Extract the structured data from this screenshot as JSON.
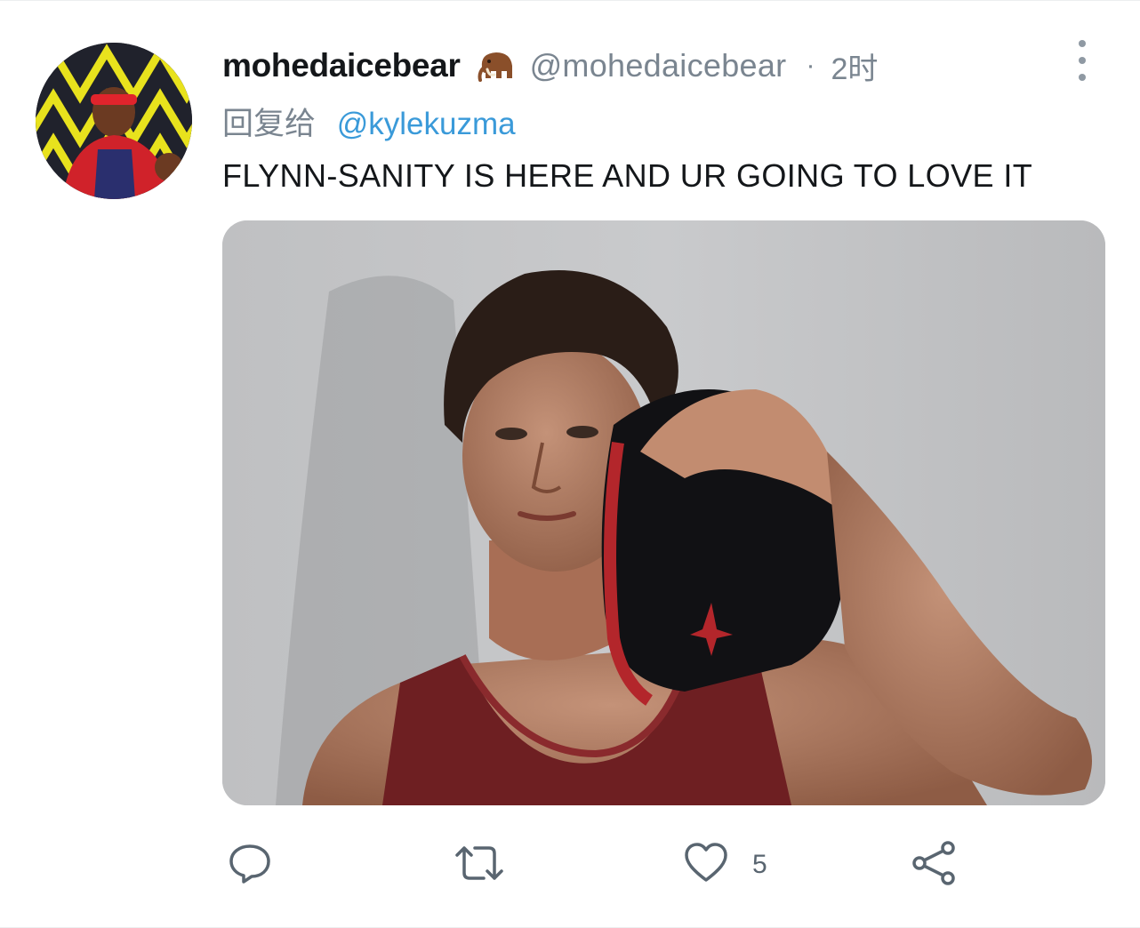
{
  "tweet": {
    "author_name": "mohedaicebear",
    "author_emoji_icon": "mammoth-icon",
    "handle": "@mohedaicebear",
    "separator": "·",
    "time": "2时",
    "reply_label": "回复给",
    "reply_mention": "@kylekuzma",
    "text": "FLYNN-SANITY IS HERE AND UR GOING TO LOVE IT"
  },
  "actions": {
    "reply_icon": "comment-icon",
    "retweet_icon": "retweet-icon",
    "like_icon": "heart-icon",
    "like_count": "5",
    "share_icon": "share-icon"
  },
  "colors": {
    "text_primary": "#14171a",
    "text_secondary": "#7a8590",
    "link": "#3a9ad9",
    "icon": "#596570"
  }
}
